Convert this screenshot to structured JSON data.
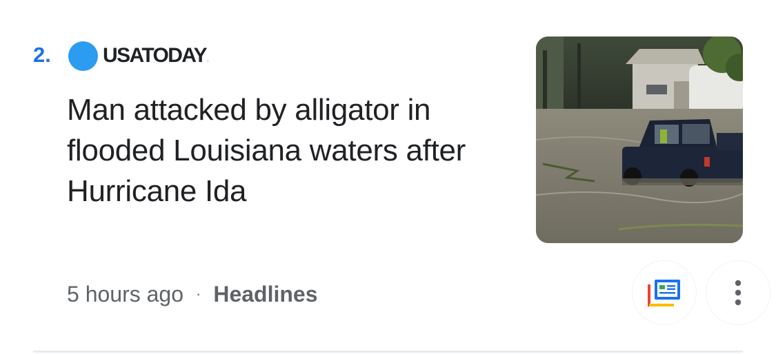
{
  "article": {
    "rank": "2.",
    "source_name": "USATODAY",
    "source_trademark": ".",
    "headline": "Man attacked by alligator in flooded Louisiana waters after Hurricane Ida",
    "time_ago": "5 hours ago",
    "separator": "·",
    "section": "Headlines",
    "thumbnail_icon": "flooded-truck-photo"
  },
  "actions": {
    "coverage_icon": "full-coverage-icon",
    "more_icon": "more-vert-icon"
  },
  "colors": {
    "rank": "#1a73e8",
    "source_dot": "#2b9cf0",
    "text_primary": "#202124",
    "text_secondary": "#5f6368"
  }
}
